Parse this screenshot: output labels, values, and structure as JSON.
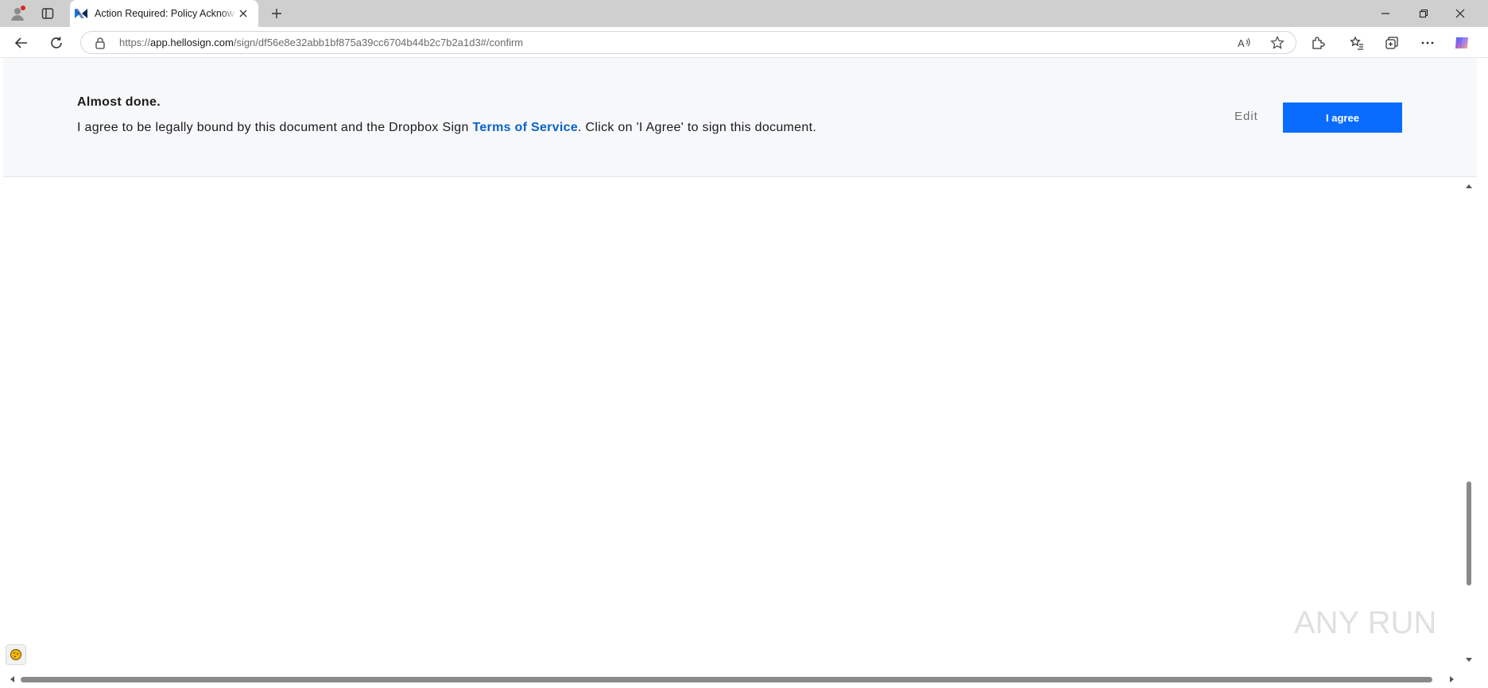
{
  "browser": {
    "tab": {
      "title": "Action Required: Policy Acknowledgement"
    },
    "address": {
      "scheme": "https://",
      "host": "app.hellosign.com",
      "path": "/sign/df56e8e32abb1bf875a39cc6704b44b2c7b2a1d3#/confirm"
    }
  },
  "banner": {
    "title": "Almost done.",
    "text_before": "I agree to be legally bound by this document and the Dropbox Sign ",
    "link": "Terms of Service",
    "text_after": ". Click on 'I Agree' to sign this document.",
    "edit_label": "Edit",
    "agree_label": "I agree"
  },
  "watermark": {
    "text": "ANY RUN"
  },
  "colors": {
    "agree_button": "#0a6cff",
    "link": "#0a63c9",
    "banner_bg": "#f7f8fa"
  }
}
